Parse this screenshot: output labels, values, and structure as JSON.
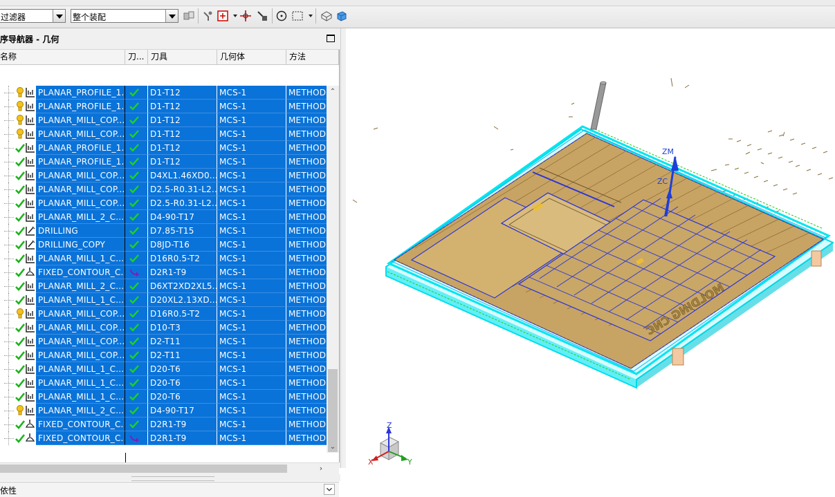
{
  "toolbar": {
    "filter_combo": "过滤器",
    "assembly_combo": "整个装配",
    "icons": [
      "filter-icon",
      "snap-point-icon",
      "point-select-icon",
      "dropdown-icon",
      "cursor-location-icon",
      "move-cursor-icon",
      "selection-circle-icon",
      "rectangle-select-icon",
      "dropdown-icon",
      "part-view-icon",
      "shaded-box-icon"
    ]
  },
  "navigator": {
    "title": "序导航器 - 几何",
    "columns": {
      "name": "名称",
      "toolpath": "刀...",
      "tool": "刀具",
      "geometry": "几何体",
      "method": "方法"
    },
    "rows": [
      {
        "status": "warn",
        "type": "planar",
        "name": "PLANAR_PROFILE_1...",
        "toolpath": "ok",
        "tool": "D1-T12",
        "geometry": "MCS-1",
        "method": "METHOD"
      },
      {
        "status": "warn",
        "type": "planar",
        "name": "PLANAR_PROFILE_1...",
        "toolpath": "ok",
        "tool": "D1-T12",
        "geometry": "MCS-1",
        "method": "METHOD"
      },
      {
        "status": "warn",
        "type": "planar",
        "name": "PLANAR_MILL_COP...",
        "toolpath": "ok",
        "tool": "D1-T12",
        "geometry": "MCS-1",
        "method": "METHOD"
      },
      {
        "status": "warn",
        "type": "planar",
        "name": "PLANAR_MILL_COP...",
        "toolpath": "ok",
        "tool": "D1-T12",
        "geometry": "MCS-1",
        "method": "METHOD"
      },
      {
        "status": "ok",
        "type": "planar",
        "name": "PLANAR_PROFILE_1...",
        "toolpath": "ok",
        "tool": "D1-T12",
        "geometry": "MCS-1",
        "method": "METHOD"
      },
      {
        "status": "ok",
        "type": "planar",
        "name": "PLANAR_PROFILE_1...",
        "toolpath": "ok",
        "tool": "D1-T12",
        "geometry": "MCS-1",
        "method": "METHOD"
      },
      {
        "status": "ok",
        "type": "planar",
        "name": "PLANAR_MILL_COP...",
        "toolpath": "ok",
        "tool": "D4XL1.46XD0...",
        "geometry": "MCS-1",
        "method": "METHOD"
      },
      {
        "status": "ok",
        "type": "planar",
        "name": "PLANAR_MILL_COP...",
        "toolpath": "ok",
        "tool": "D2.5-R0.31-L2...",
        "geometry": "MCS-1",
        "method": "METHOD"
      },
      {
        "status": "ok",
        "type": "planar",
        "name": "PLANAR_MILL_COP...",
        "toolpath": "ok",
        "tool": "D2.5-R0.31-L2...",
        "geometry": "MCS-1",
        "method": "METHOD"
      },
      {
        "status": "ok",
        "type": "planar",
        "name": "PLANAR_MILL_2_C...",
        "toolpath": "ok",
        "tool": "D4-90-T17",
        "geometry": "MCS-1",
        "method": "METHOD"
      },
      {
        "status": "ok",
        "type": "drill",
        "name": "DRILLING",
        "toolpath": "ok",
        "tool": "D7.85-T15",
        "geometry": "MCS-1",
        "method": "METHOD"
      },
      {
        "status": "ok",
        "type": "drill",
        "name": "DRILLING_COPY",
        "toolpath": "ok",
        "tool": "D8JD-T16",
        "geometry": "MCS-1",
        "method": "METHOD"
      },
      {
        "status": "ok",
        "type": "planar",
        "name": "PLANAR_MILL_1_C...",
        "toolpath": "ok",
        "tool": "D16R0.5-T2",
        "geometry": "MCS-1",
        "method": "METHOD"
      },
      {
        "status": "ok",
        "type": "contour",
        "name": "FIXED_CONTOUR_C...",
        "toolpath": "regen",
        "tool": "D2R1-T9",
        "geometry": "MCS-1",
        "method": "METHOD"
      },
      {
        "status": "ok",
        "type": "planar",
        "name": "PLANAR_MILL_2_C...",
        "toolpath": "ok",
        "tool": "D6XT2XD2XL5...",
        "geometry": "MCS-1",
        "method": "METHOD"
      },
      {
        "status": "ok",
        "type": "planar",
        "name": "PLANAR_MILL_1_C...",
        "toolpath": "ok",
        "tool": "D20XL2.13XD...",
        "geometry": "MCS-1",
        "method": "METHOD"
      },
      {
        "status": "warn",
        "type": "planar",
        "name": "PLANAR_MILL_COP...",
        "toolpath": "ok",
        "tool": "D16R0.5-T2",
        "geometry": "MCS-1",
        "method": "METHOD"
      },
      {
        "status": "ok",
        "type": "planar",
        "name": "PLANAR_MILL_COP...",
        "toolpath": "ok",
        "tool": "D10-T3",
        "geometry": "MCS-1",
        "method": "METHOD"
      },
      {
        "status": "ok",
        "type": "planar",
        "name": "PLANAR_MILL_COP...",
        "toolpath": "ok",
        "tool": "D2-T11",
        "geometry": "MCS-1",
        "method": "METHOD"
      },
      {
        "status": "ok",
        "type": "planar",
        "name": "PLANAR_MILL_COP...",
        "toolpath": "ok",
        "tool": "D2-T11",
        "geometry": "MCS-1",
        "method": "METHOD"
      },
      {
        "status": "ok",
        "type": "planar",
        "name": "PLANAR_MILL_1_C...",
        "toolpath": "ok",
        "tool": "D20-T6",
        "geometry": "MCS-1",
        "method": "METHOD"
      },
      {
        "status": "ok",
        "type": "planar",
        "name": "PLANAR_MILL_1_C...",
        "toolpath": "ok",
        "tool": "D20-T6",
        "geometry": "MCS-1",
        "method": "METHOD"
      },
      {
        "status": "ok",
        "type": "planar",
        "name": "PLANAR_MILL_1_C...",
        "toolpath": "ok",
        "tool": "D20-T6",
        "geometry": "MCS-1",
        "method": "METHOD"
      },
      {
        "status": "warn",
        "type": "planar",
        "name": "PLANAR_MILL_2_C...",
        "toolpath": "ok",
        "tool": "D4-90-T17",
        "geometry": "MCS-1",
        "method": "METHOD"
      },
      {
        "status": "ok",
        "type": "contour",
        "name": "FIXED_CONTOUR_C...",
        "toolpath": "ok",
        "tool": "D2R1-T9",
        "geometry": "MCS-1",
        "method": "METHOD"
      },
      {
        "status": "ok",
        "type": "contour",
        "name": "FIXED_CONTOUR_C...",
        "toolpath": "regen",
        "tool": "D2R1-T9",
        "geometry": "MCS-1",
        "method": "METHOD"
      }
    ],
    "dependencies_label": "依性"
  },
  "viewport": {
    "csys_labels": {
      "zm": "ZM",
      "zc": "ZC"
    },
    "triad_labels": {
      "z": "Z",
      "x": "X",
      "y": "Y"
    },
    "part_engraving": "MOLDING CNC",
    "colors": {
      "wireframe": "#00e5f0",
      "part": "#c8a464",
      "toolpath": "#2b35d8",
      "tool": "#8c8c8c",
      "selection": "#0a73d9"
    }
  }
}
